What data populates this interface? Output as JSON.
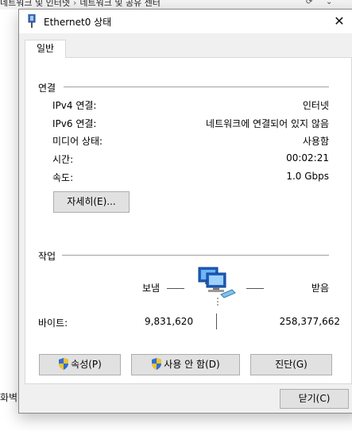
{
  "background": {
    "breadcrumb": [
      "네트워크 및 인터넷",
      "네트워크 및 공유 센터"
    ],
    "side_text": "화벽"
  },
  "window": {
    "title": "Ethernet0 상태",
    "close_glyph": "✕"
  },
  "tabs": [
    {
      "label": "일반"
    }
  ],
  "connection": {
    "group_label": "연결",
    "rows": [
      {
        "label": "IPv4 연결:",
        "value": "인터넷"
      },
      {
        "label": "IPv6 연결:",
        "value": "네트워크에 연결되어 있지 않음"
      },
      {
        "label": "미디어 상태:",
        "value": "사용함"
      },
      {
        "label": "시간:",
        "value": "00:02:21"
      },
      {
        "label": "속도:",
        "value": "1.0 Gbps"
      }
    ],
    "details_button": "자세히(E)..."
  },
  "activity": {
    "group_label": "작업",
    "sent_label": "보냄",
    "received_label": "받음",
    "bytes_label": "바이트:",
    "bytes_sent": "9,831,620",
    "bytes_received": "258,377,662"
  },
  "actions": {
    "properties_button": "속성(P)",
    "disable_button": "사용 안 함(D)",
    "diagnose_button": "진단(G)"
  },
  "footer": {
    "close_button": "닫기(C)"
  },
  "colors": {
    "dialog_bg": "#f0f0f0",
    "panel_bg": "#ffffff",
    "button_bg": "#e1e1e1",
    "button_border": "#adadad"
  }
}
